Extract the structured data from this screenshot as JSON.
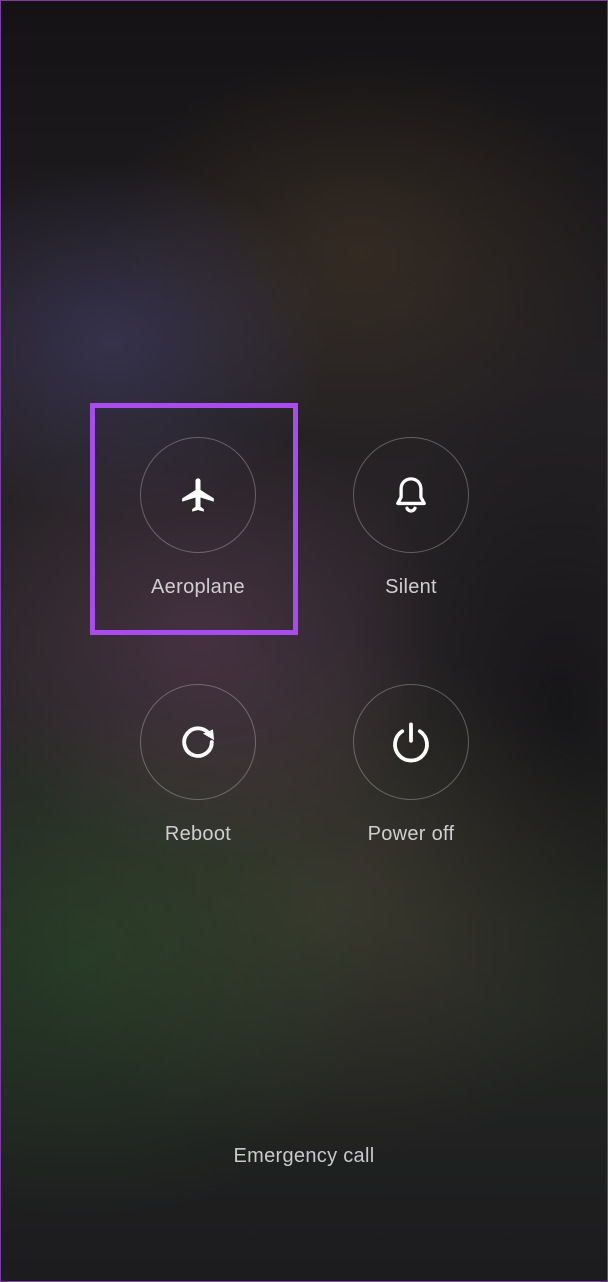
{
  "power_menu": {
    "actions": [
      {
        "id": "aeroplane",
        "label": "Aeroplane",
        "icon": "airplane-icon"
      },
      {
        "id": "silent",
        "label": "Silent",
        "icon": "bell-icon"
      },
      {
        "id": "reboot",
        "label": "Reboot",
        "icon": "reboot-icon"
      },
      {
        "id": "power_off",
        "label": "Power off",
        "icon": "power-icon"
      }
    ],
    "highlighted_action": "aeroplane",
    "highlight_color": "#a84cf0"
  },
  "footer": {
    "emergency_label": "Emergency call"
  }
}
